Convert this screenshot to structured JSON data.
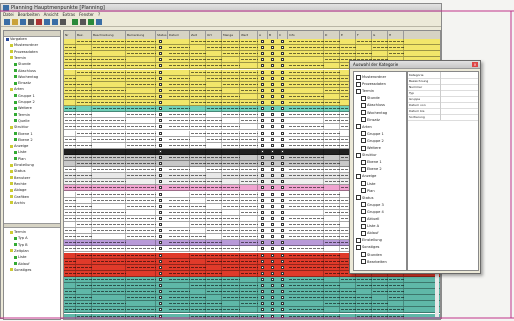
{
  "window": {
    "title": "Planning Hauptmenpunkte [Planning]"
  },
  "menu": [
    "Datei",
    "Bearbeiten",
    "Ansicht",
    "Extras",
    "Fenster",
    "?"
  ],
  "toolbar_icons": [
    "new-icon",
    "open-icon",
    "save-icon",
    "print-icon",
    "cut-icon",
    "copy-icon",
    "paste-icon",
    "undo-icon",
    "filter-icon",
    "sort-icon",
    "refresh-icon",
    "help-icon"
  ],
  "left_tree": [
    {
      "label": "Vorgaben",
      "depth": 0,
      "color": "#2a4a9a"
    },
    {
      "label": "Musterordner",
      "depth": 1,
      "color": "#cc3"
    },
    {
      "label": "Prozessdaten",
      "depth": 1,
      "color": "#cc3"
    },
    {
      "label": "Termin",
      "depth": 1,
      "color": "#cc3"
    },
    {
      "label": "Stunde",
      "depth": 2,
      "color": "#3a3"
    },
    {
      "label": "Abschluss",
      "depth": 2,
      "color": "#3a3"
    },
    {
      "label": "Wochentag",
      "depth": 2,
      "color": "#3a3"
    },
    {
      "label": "Einsatz",
      "depth": 2,
      "color": "#3a3"
    },
    {
      "label": "Arten",
      "depth": 1,
      "color": "#cc3"
    },
    {
      "label": "Gruppe 1",
      "depth": 2,
      "color": "#3a3"
    },
    {
      "label": "Gruppe 2",
      "depth": 2,
      "color": "#3a3"
    },
    {
      "label": "Weitere",
      "depth": 2,
      "color": "#3a3"
    },
    {
      "label": "Termin",
      "depth": 2,
      "color": "#3a3"
    },
    {
      "label": "Quelle",
      "depth": 2,
      "color": "#3a3"
    },
    {
      "label": "Struktur",
      "depth": 1,
      "color": "#cc3"
    },
    {
      "label": "Ebene 1",
      "depth": 2,
      "color": "#3a3"
    },
    {
      "label": "Ebene 2",
      "depth": 2,
      "color": "#3a3"
    },
    {
      "label": "Anzeige",
      "depth": 1,
      "color": "#cc3"
    },
    {
      "label": "Liste",
      "depth": 2,
      "color": "#3a3"
    },
    {
      "label": "Plan",
      "depth": 2,
      "color": "#3a3"
    },
    {
      "label": "Einstellung",
      "depth": 1,
      "color": "#cc3"
    },
    {
      "label": "Status",
      "depth": 1,
      "color": "#cc3"
    },
    {
      "label": "Benutzer",
      "depth": 1,
      "color": "#cc3"
    },
    {
      "label": "Rechte",
      "depth": 1,
      "color": "#cc3"
    },
    {
      "label": "Ablage",
      "depth": 1,
      "color": "#cc3"
    },
    {
      "label": "Grafiken",
      "depth": 1,
      "color": "#cc3"
    },
    {
      "label": "Archiv",
      "depth": 1,
      "color": "#cc3"
    }
  ],
  "left_tree_lower": [
    {
      "label": "Termin",
      "depth": 1,
      "color": "#cc3"
    },
    {
      "label": "Typ A",
      "depth": 2,
      "color": "#3a3"
    },
    {
      "label": "Typ B",
      "depth": 2,
      "color": "#3a3"
    },
    {
      "label": "Zeitplan",
      "depth": 1,
      "color": "#cc3"
    },
    {
      "label": "Liste",
      "depth": 2,
      "color": "#3a3"
    },
    {
      "label": "Ablauf",
      "depth": 2,
      "color": "#3a3"
    },
    {
      "label": "Sonstiges",
      "depth": 1,
      "color": "#cc3"
    }
  ],
  "grid": {
    "columns": [
      "Nr",
      "Bez.",
      "Beschreibung",
      "Bemerkung",
      "Status",
      "Datum",
      "Zeit",
      "Ort",
      "Menge",
      "Wert",
      "A",
      "B",
      "C",
      "Info",
      "D",
      "E",
      "F",
      "G",
      "H"
    ],
    "row_colors": [
      "#f2e66a",
      "#f2e66a",
      "#f2e66a",
      "#f2e66a",
      "#f2e66a",
      "#f2e66a",
      "#f2e66a",
      "#f2e66a",
      "#f2e66a",
      "#f2e66a",
      "#f2e66a",
      "#6fcfb8",
      "#ffffff",
      "#ffffff",
      "#ffffff",
      "#ffffff",
      "#ffffff",
      "#ffffff",
      "#202020",
      "#c8c8c8",
      "#c8c8c8",
      "#ffffff",
      "#e8e8e8",
      "#f0f0f0",
      "#f0a4d0",
      "#ffffff",
      "#ffffff",
      "#ffffff",
      "#ffffff",
      "#ffffff",
      "#ffffff",
      "#ffffff",
      "#ffffff",
      "#b89ad8",
      "#ffffff",
      "#e03a2a",
      "#e03a2a",
      "#e03a2a",
      "#e03a2a",
      "#5fb8a8",
      "#5fb8a8",
      "#5fb8a8",
      "#5fb8a8",
      "#5fb8a8",
      "#5fb8a8",
      "#5fb8a8"
    ]
  },
  "dialog": {
    "title": "Auswahl der Kategorie",
    "tree": [
      "Musterordner",
      "Prozessdaten",
      "Termin",
      "Stunde",
      "Abschluss",
      "Wochentag",
      "Einsatz",
      "Arten",
      "Gruppe 1",
      "Gruppe 2",
      "Weitere",
      "Struktur",
      "Ebene 1",
      "Ebene 2",
      "Anzeige",
      "Liste",
      "Plan",
      "Status",
      "Gruppe 3",
      "Gruppe 4",
      "Aktuell",
      "Liste A",
      "Ablauf",
      "Einstellung",
      "Sonstiges",
      "Stunden",
      "Bearbeiten"
    ],
    "props": [
      "Kategorie",
      "Bezeichnung",
      "Nummer",
      "Typ",
      "Gruppe",
      "Datum von",
      "Datum bis",
      "Sortierung"
    ]
  }
}
